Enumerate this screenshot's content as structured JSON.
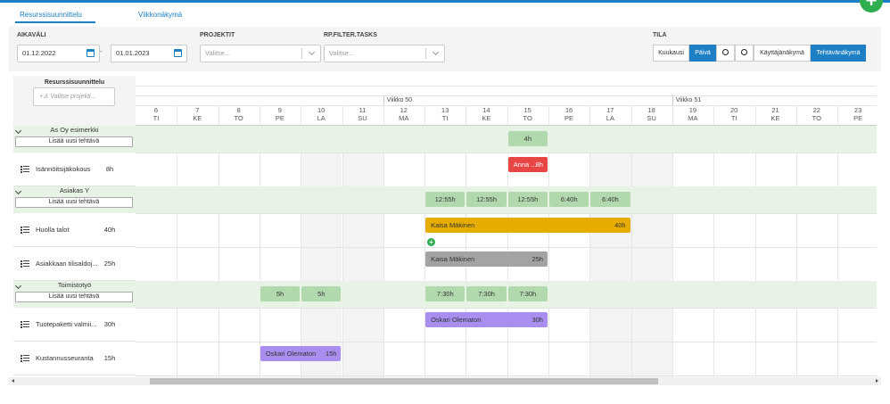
{
  "tabs": [
    {
      "label": "Resurssisuunnittelu",
      "active": true
    },
    {
      "label": "Viikkonäkymä",
      "active": false
    }
  ],
  "filters": {
    "period_label": "AIKAVÄLI",
    "date_from": "01.12.2022",
    "date_sep": "-",
    "date_to": "01.01.2023",
    "projects_label": "PROJEKTIT",
    "projects_placeholder": "Valitse...",
    "tasks_label": "RP.FILTER.TASKS",
    "tasks_placeholder": "Valitse...",
    "state_label": "TILA"
  },
  "view_buttons": {
    "month": "Kuukausi",
    "day": "Päivä",
    "zoom_in_icon": "zoom-in-icon",
    "zoom_out_icon": "zoom-out-icon",
    "user_view": "Käyttäjänäkymä",
    "task_view": "Tehtävänäkymä"
  },
  "left": {
    "title": "Resurssisuunnittelu",
    "project_placeholder": "Valitse projekti..."
  },
  "weeks": [
    "Viikko 50",
    "Viikko 51"
  ],
  "days": [
    {
      "num": "6",
      "wd": "TI"
    },
    {
      "num": "7",
      "wd": "KE"
    },
    {
      "num": "8",
      "wd": "TO"
    },
    {
      "num": "9",
      "wd": "PE"
    },
    {
      "num": "10",
      "wd": "LA"
    },
    {
      "num": "11",
      "wd": "SU"
    },
    {
      "num": "12",
      "wd": "MA"
    },
    {
      "num": "13",
      "wd": "TI"
    },
    {
      "num": "14",
      "wd": "KE"
    },
    {
      "num": "15",
      "wd": "TO"
    },
    {
      "num": "16",
      "wd": "PE"
    },
    {
      "num": "17",
      "wd": "LA"
    },
    {
      "num": "18",
      "wd": "SU"
    },
    {
      "num": "19",
      "wd": "MA"
    },
    {
      "num": "20",
      "wd": "TI"
    },
    {
      "num": "21",
      "wd": "KE"
    },
    {
      "num": "22",
      "wd": "TO"
    },
    {
      "num": "23",
      "wd": "PE"
    }
  ],
  "add_task_label": "Lisää uusi tehtävä",
  "groups": [
    {
      "name": "As Oy esimerkki",
      "sums": [
        {
          "day": 9,
          "text": "4h"
        }
      ],
      "tasks": [
        {
          "name": "Isännöitsijäkokous",
          "hours": "8h",
          "bars": [
            {
              "start": 9,
              "span": 1,
              "text": "Anna ...",
              "hours": "8h",
              "color": "#e84545"
            }
          ]
        }
      ]
    },
    {
      "name": "Asiakas Y",
      "sums": [
        {
          "day": 7,
          "text": "12:55h"
        },
        {
          "day": 8,
          "text": "12:55h"
        },
        {
          "day": 9,
          "text": "12:55h"
        },
        {
          "day": 10,
          "text": "6:40h"
        },
        {
          "day": 11,
          "text": "6:40h"
        }
      ],
      "tasks": [
        {
          "name": "Huolla talot",
          "hours": "40h",
          "bars": [
            {
              "start": 7,
              "span": 5,
              "text": "Kaisa Mäkinen",
              "hours": "40h",
              "color": "#e6ad00"
            }
          ]
        },
        {
          "name": "Asiakkaan tilisaldoj...",
          "hours": "25h",
          "bars": [
            {
              "start": 7,
              "span": 3,
              "text": "Kaisa Mäkinen",
              "hours": "25h",
              "color": "#a3a3a3"
            }
          ]
        }
      ]
    },
    {
      "name": "Toimistotyö",
      "sums": [
        {
          "day": 3,
          "text": "5h"
        },
        {
          "day": 4,
          "text": "5h"
        },
        {
          "day": 7,
          "text": "7:30h"
        },
        {
          "day": 8,
          "text": "7:30h"
        },
        {
          "day": 9,
          "text": "7:30h"
        }
      ],
      "tasks": [
        {
          "name": "Tuotepaketti valmii...",
          "hours": "30h",
          "bars": [
            {
              "start": 7,
              "span": 3,
              "text": "Oskari Olematon",
              "hours": "30h",
              "color": "#a98ef0"
            }
          ]
        },
        {
          "name": "Kustannusseuranta",
          "hours": "15h",
          "bars": [
            {
              "start": 3,
              "span": 2,
              "text": "Oskari Olematon",
              "hours": "15h",
              "color": "#a98ef0"
            }
          ]
        }
      ]
    }
  ],
  "colors": {
    "accent": "#1d7fc4",
    "group_bg": "#e7f3e4",
    "sum_pill": "#b2d9ad",
    "add": "#2eae4e"
  }
}
